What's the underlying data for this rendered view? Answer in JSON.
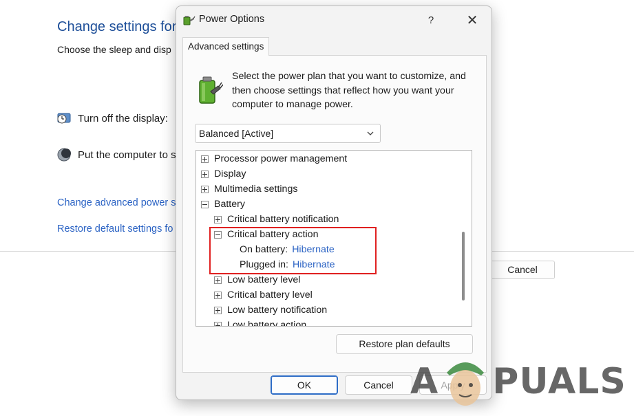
{
  "background": {
    "title": "Change settings for",
    "subtitle": "Choose the sleep and disp",
    "display_label": "Turn off the display:",
    "sleep_label": "Put the computer to s",
    "advanced_link": "Change advanced power s",
    "restore_link": "Restore default settings fo",
    "cancel_label": "Cancel"
  },
  "dialog": {
    "title": "Power Options",
    "help": "?",
    "close": "✕",
    "tab": "Advanced settings",
    "description": "Select the power plan that you want to customize, and then choose settings that reflect how you want your computer to manage power.",
    "plan_selected": "Balanced [Active]",
    "tree": {
      "processor": "Processor power management",
      "display": "Display",
      "multimedia": "Multimedia settings",
      "battery": "Battery",
      "critical_notification": "Critical battery notification",
      "critical_action": "Critical battery action",
      "on_battery_label": "On battery:",
      "on_battery_value": "Hibernate",
      "plugged_in_label": "Plugged in:",
      "plugged_in_value": "Hibernate",
      "low_level": "Low battery level",
      "critical_level": "Critical battery level",
      "low_notification": "Low battery notification",
      "low_action": "Low battery action"
    },
    "restore_defaults": "Restore plan defaults",
    "ok": "OK",
    "cancel": "Cancel",
    "apply": "Apply"
  },
  "watermark": {
    "left": "A",
    "right": "PUALS"
  },
  "colors": {
    "link": "#2b63c4",
    "title_blue": "#1e4f99",
    "highlight": "#e02020",
    "ok_border": "#2d6cc6"
  },
  "icons": [
    "power-options-icon",
    "battery-plug-icon",
    "clock-icon",
    "moon-icon",
    "chevron-down-icon",
    "close-icon",
    "help-icon"
  ]
}
